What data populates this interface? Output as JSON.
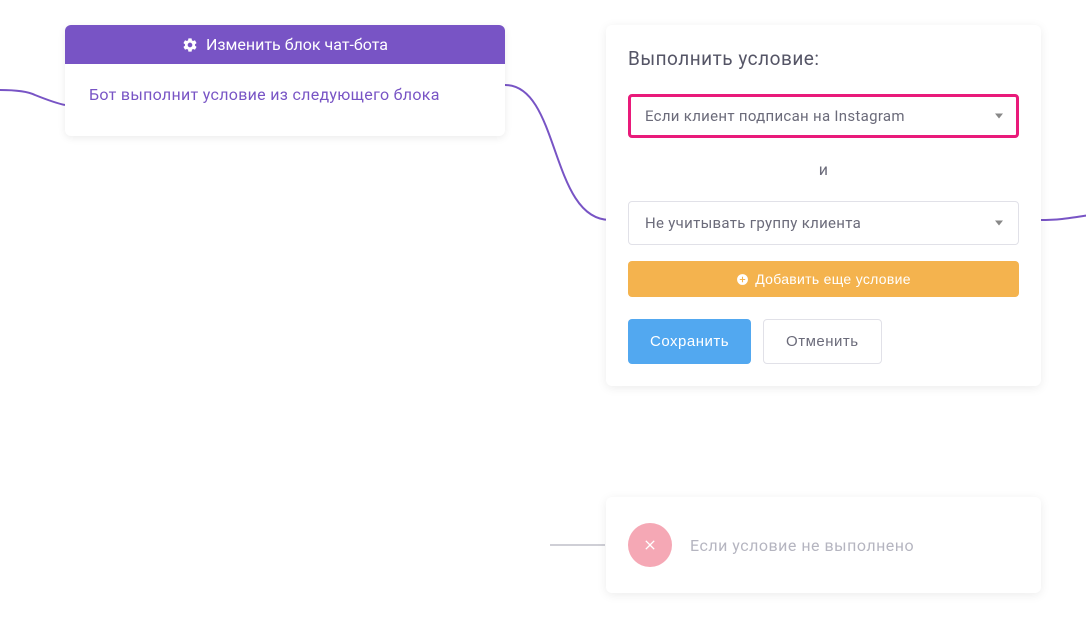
{
  "leftBlock": {
    "headerLabel": "Изменить блок чат-бота",
    "bodyText": "Бот выполнит условие из следующего блока"
  },
  "conditionPanel": {
    "title": "Выполнить условие:",
    "select1": "Если клиент подписан на Instagram",
    "separatorLabel": "и",
    "select2": "Не учитывать группу клиента",
    "addConditionLabel": "Добавить еще условие",
    "saveLabel": "Сохранить",
    "cancelLabel": "Отменить"
  },
  "notFulfilled": {
    "text": "Если условие не выполнено"
  }
}
